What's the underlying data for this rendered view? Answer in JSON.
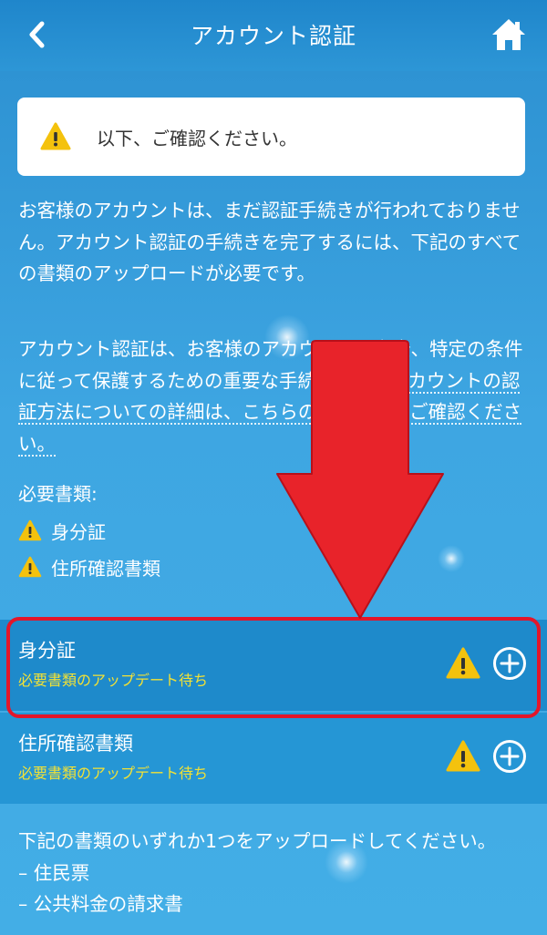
{
  "header": {
    "title": "アカウント認証",
    "back_icon": "chevron-left-icon",
    "home_icon": "home-icon"
  },
  "notice": {
    "icon": "warning-icon",
    "text": "以下、ご確認ください。"
  },
  "intro": {
    "paragraph1": "お客様のアカウントは、まだ認証手続きが行われておりません。アカウント認証の手続きを完了するには、下記のすべての書類のアップロードが必要です。",
    "paragraph2_lead": "アカウント認証は、お客様のアカウントの安全、特定の条件に従って保護するための重要な手続きです。",
    "paragraph2_link": "アカウントの認証方法についての詳細は、こちらのページよりご確認ください。"
  },
  "required": {
    "heading": "必要書類:",
    "items": [
      "身分証",
      "住所確認書類"
    ]
  },
  "documents": [
    {
      "title": "身分証",
      "status": "必要書類のアップデート待ち"
    },
    {
      "title": "住所確認書類",
      "status": "必要書類のアップデート待ち"
    }
  ],
  "footer_text": {
    "lead": "下記の書類のいずれか1つをアップロードしてください。",
    "items": [
      "– 住民票",
      "– 公共料金の請求書"
    ]
  },
  "colors": {
    "background": "#3ea6e2",
    "header": "#1f86cb",
    "status_text": "#f2e135",
    "warning": "#f4c20d",
    "highlight": "#e3162a"
  }
}
